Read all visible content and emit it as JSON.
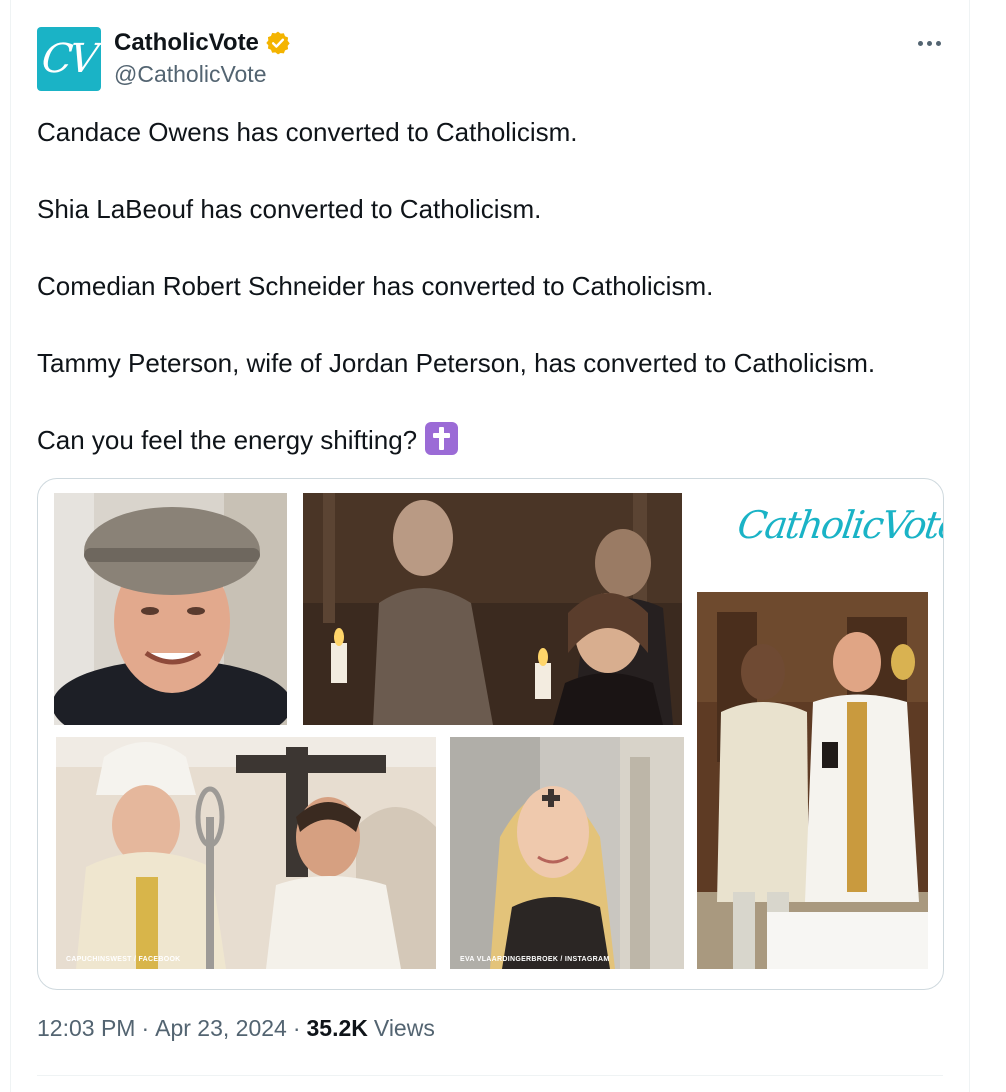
{
  "author": {
    "display_name": "CatholicVote",
    "handle": "@CatholicVote",
    "avatar_text": "CV",
    "verified": true,
    "verified_color": "#f4b400"
  },
  "tweet": {
    "paragraphs": [
      "Candace Owens has converted to Catholicism.",
      "Shia LaBeouf has converted to Catholicism.",
      "Comedian Robert Schneider has converted to Catholicism.",
      "Tammy Peterson, wife of Jordan Peterson, has converted to Catholicism.",
      "Can you feel the energy shifting?"
    ],
    "emoji": "latin-cross-emoji"
  },
  "media": {
    "logo_text": "CatholicVote",
    "photo_credits": [
      "CAPUCHINSWEST / FACEBOOK",
      "EVA VLAARDINGERBROEK / INSTAGRAM"
    ]
  },
  "meta": {
    "time": "12:03 PM",
    "separator": "·",
    "date": "Apr 23, 2024",
    "views_count": "35.2K",
    "views_label": "Views"
  },
  "colors": {
    "accent": "#1ab3c6",
    "text_primary": "#0f1419",
    "text_secondary": "#536471",
    "border": "#cfd9de"
  }
}
